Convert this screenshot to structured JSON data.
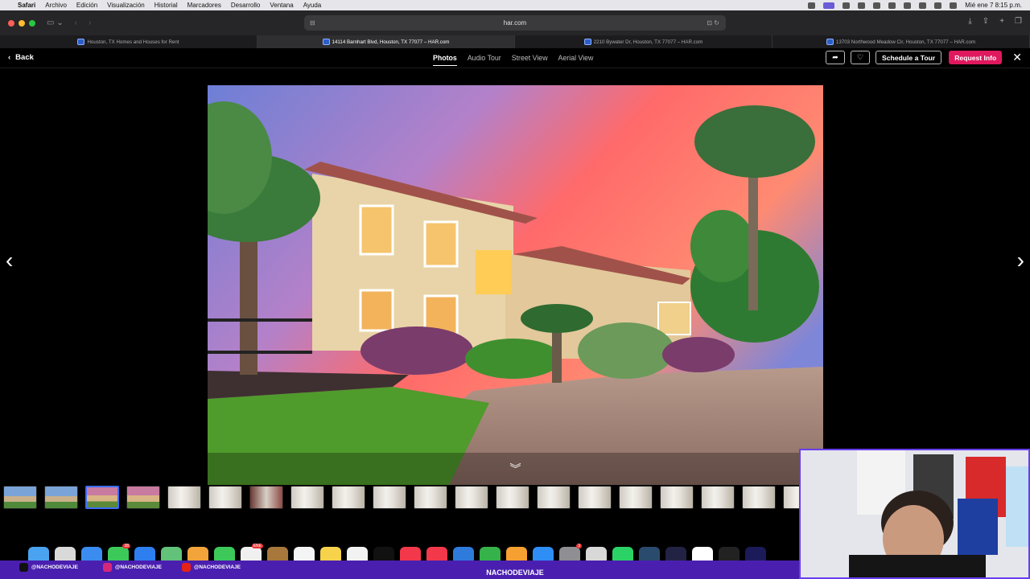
{
  "menubar": {
    "apple": "",
    "items": [
      "Safari",
      "Archivo",
      "Edición",
      "Visualización",
      "Historial",
      "Marcadores",
      "Desarrollo",
      "Ventana",
      "Ayuda"
    ],
    "clock": "Mié ene 7  8:15 p.m."
  },
  "browser": {
    "url": "har.com",
    "tabs": [
      {
        "label": "Houston, TX Homes and Houses for Rent",
        "active": false
      },
      {
        "label": "14114 Barnhart Blvd, Houston, TX 77077 – HAR.com",
        "active": true
      },
      {
        "label": "2210 Bywater Dr, Houston, TX 77077 – HAR.com",
        "active": false
      },
      {
        "label": "13703 Northwood Meadow Cir, Houston, TX 77077 – HAR.com",
        "active": false
      }
    ]
  },
  "gallery": {
    "back_label": "Back",
    "view_tabs": [
      {
        "label": "Photos",
        "active": true
      },
      {
        "label": "Audio Tour",
        "active": false
      },
      {
        "label": "Street View",
        "active": false
      },
      {
        "label": "Aerial View",
        "active": false
      }
    ],
    "schedule_label": "Schedule a Tour",
    "request_label": "Request Info",
    "close_glyph": "✕",
    "prev_glyph": "‹",
    "next_glyph": "›",
    "expand_glyph": "︾",
    "thumbnails": [
      {
        "kind": "exterior",
        "selected": false
      },
      {
        "kind": "exterior",
        "selected": false
      },
      {
        "kind": "exterior-dusk",
        "selected": true
      },
      {
        "kind": "exterior-dusk",
        "selected": false
      },
      {
        "kind": "interior",
        "selected": false
      },
      {
        "kind": "interior",
        "selected": false
      },
      {
        "kind": "interior-dark",
        "selected": false
      },
      {
        "kind": "interior",
        "selected": false
      },
      {
        "kind": "interior",
        "selected": false
      },
      {
        "kind": "interior",
        "selected": false
      },
      {
        "kind": "interior",
        "selected": false
      },
      {
        "kind": "interior",
        "selected": false
      },
      {
        "kind": "interior",
        "selected": false
      },
      {
        "kind": "interior",
        "selected": false
      },
      {
        "kind": "interior",
        "selected": false
      },
      {
        "kind": "interior",
        "selected": false
      },
      {
        "kind": "interior",
        "selected": false
      },
      {
        "kind": "interior",
        "selected": false
      },
      {
        "kind": "interior",
        "selected": false
      },
      {
        "kind": "interior",
        "selected": false
      }
    ]
  },
  "dock": {
    "apps": [
      {
        "name": "finder",
        "color": "#4aa3f0"
      },
      {
        "name": "launchpad",
        "color": "#d9d9d9"
      },
      {
        "name": "safari",
        "color": "#3b8cf0"
      },
      {
        "name": "messages",
        "color": "#3cc95a",
        "badge": "38"
      },
      {
        "name": "mail",
        "color": "#2d7ff0"
      },
      {
        "name": "maps",
        "color": "#62c27a"
      },
      {
        "name": "photos",
        "color": "#f2a33a"
      },
      {
        "name": "facetime",
        "color": "#3cc95a"
      },
      {
        "name": "calendar",
        "color": "#f0f0f0",
        "badge": "ENE"
      },
      {
        "name": "notes-brown",
        "color": "#a7773c"
      },
      {
        "name": "reminders",
        "color": "#f4f4f4"
      },
      {
        "name": "notes",
        "color": "#f7d34c"
      },
      {
        "name": "freeform",
        "color": "#f2f2f2"
      },
      {
        "name": "tv",
        "color": "#111111"
      },
      {
        "name": "music",
        "color": "#f2384a"
      },
      {
        "name": "news",
        "color": "#f2384a"
      },
      {
        "name": "keynote",
        "color": "#2f7bdc"
      },
      {
        "name": "numbers",
        "color": "#35b24a"
      },
      {
        "name": "pages",
        "color": "#f5a031"
      },
      {
        "name": "app-store",
        "color": "#2f8ef5"
      },
      {
        "name": "system-settings",
        "color": "#8e8e93",
        "badge": "3"
      },
      {
        "name": "preview",
        "color": "#d8d8d8"
      },
      {
        "name": "whatsapp",
        "color": "#2bd366"
      },
      {
        "name": "davinci",
        "color": "#2b4b6e"
      },
      {
        "name": "obs",
        "color": "#222244"
      },
      {
        "name": "capcut",
        "color": "#ffffff"
      },
      {
        "name": "chatgpt",
        "color": "#222222"
      },
      {
        "name": "premiere",
        "color": "#1b1b5a"
      }
    ]
  },
  "overlay": {
    "tiktok": "@NACHODEVIAJE",
    "instagram": "@NACHODEVIAJE",
    "youtube": "@NACHODEVIAJE",
    "channel": "NACHODEVIAJE",
    "accent": "#4a1fb0"
  }
}
